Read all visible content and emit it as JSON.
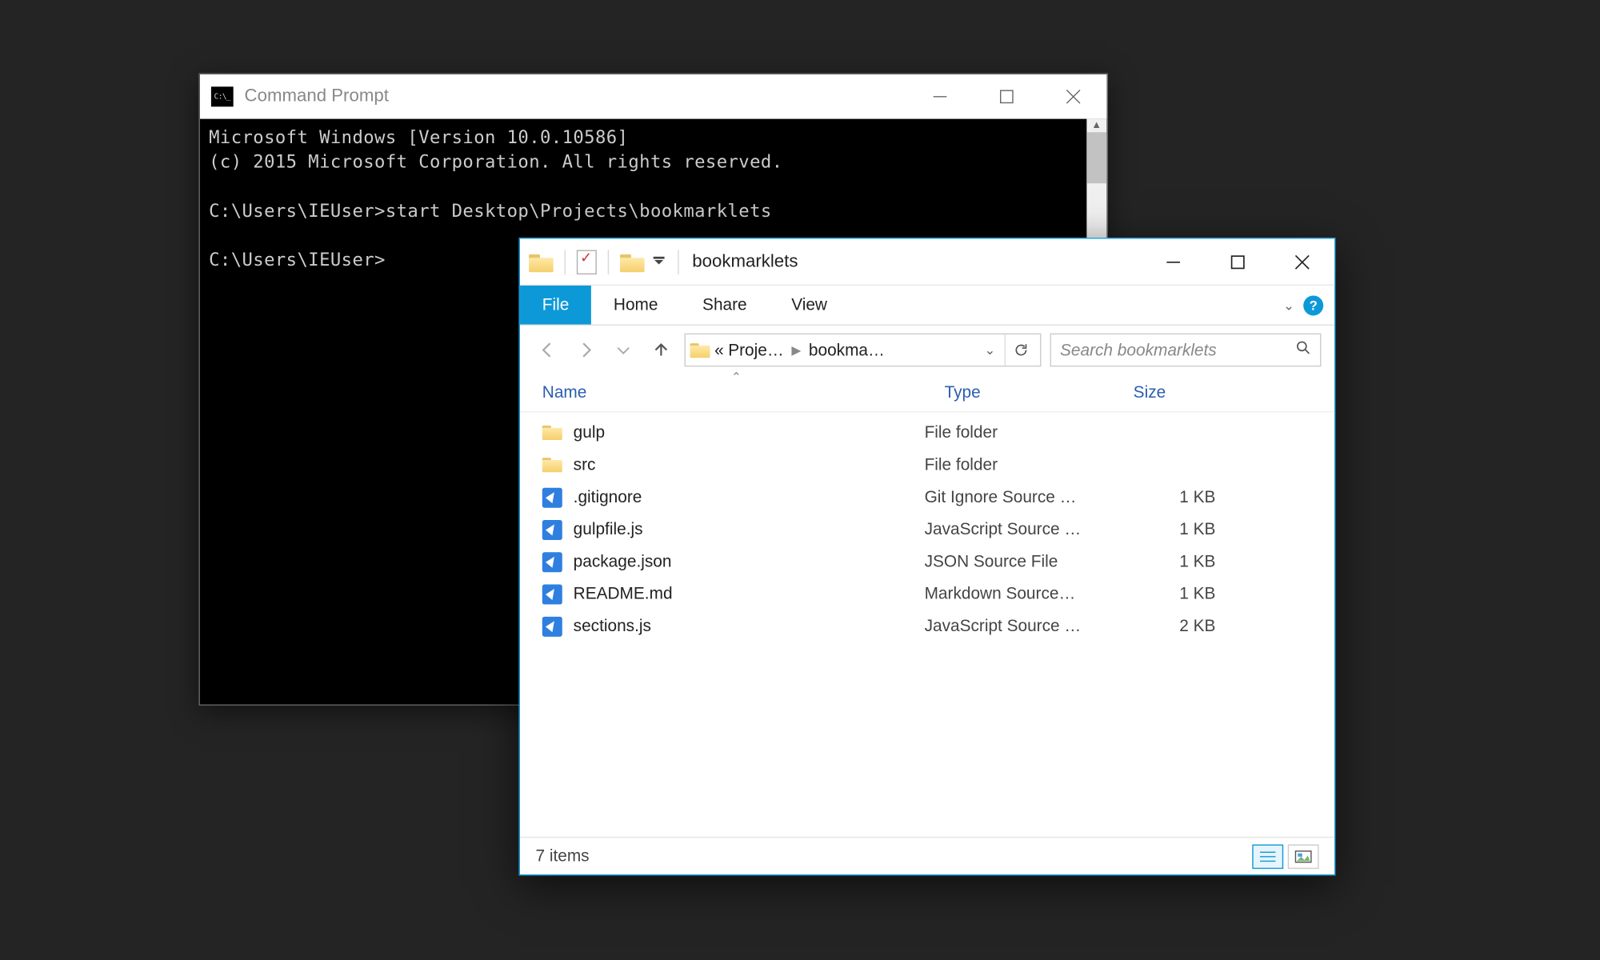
{
  "cmd": {
    "title": "Command Prompt",
    "lines": {
      "l1": "Microsoft Windows [Version 10.0.10586]",
      "l2": "(c) 2015 Microsoft Corporation. All rights reserved.",
      "blank1": "",
      "l3": "C:\\Users\\IEUser>start Desktop\\Projects\\bookmarklets",
      "blank2": "",
      "l4": "C:\\Users\\IEUser>"
    }
  },
  "explorer": {
    "title": "bookmarklets",
    "tabs": {
      "file": "File",
      "home": "Home",
      "share": "Share",
      "view": "View"
    },
    "address": {
      "overflow": "«",
      "crumb1": "Proje…",
      "crumb2": "bookma…"
    },
    "search_placeholder": "Search bookmarklets",
    "columns": {
      "name": "Name",
      "type": "Type",
      "size": "Size"
    },
    "items": [
      {
        "icon": "folder",
        "name": "gulp",
        "type": "File folder",
        "size": ""
      },
      {
        "icon": "folder",
        "name": "src",
        "type": "File folder",
        "size": ""
      },
      {
        "icon": "vscode",
        "name": ".gitignore",
        "type": "Git Ignore Source …",
        "size": "1 KB"
      },
      {
        "icon": "vscode",
        "name": "gulpfile.js",
        "type": "JavaScript Source …",
        "size": "1 KB"
      },
      {
        "icon": "vscode",
        "name": "package.json",
        "type": "JSON Source File",
        "size": "1 KB"
      },
      {
        "icon": "vscode",
        "name": "README.md",
        "type": "Markdown Source…",
        "size": "1 KB"
      },
      {
        "icon": "vscode",
        "name": "sections.js",
        "type": "JavaScript Source …",
        "size": "2 KB"
      }
    ],
    "status": "7 items"
  }
}
